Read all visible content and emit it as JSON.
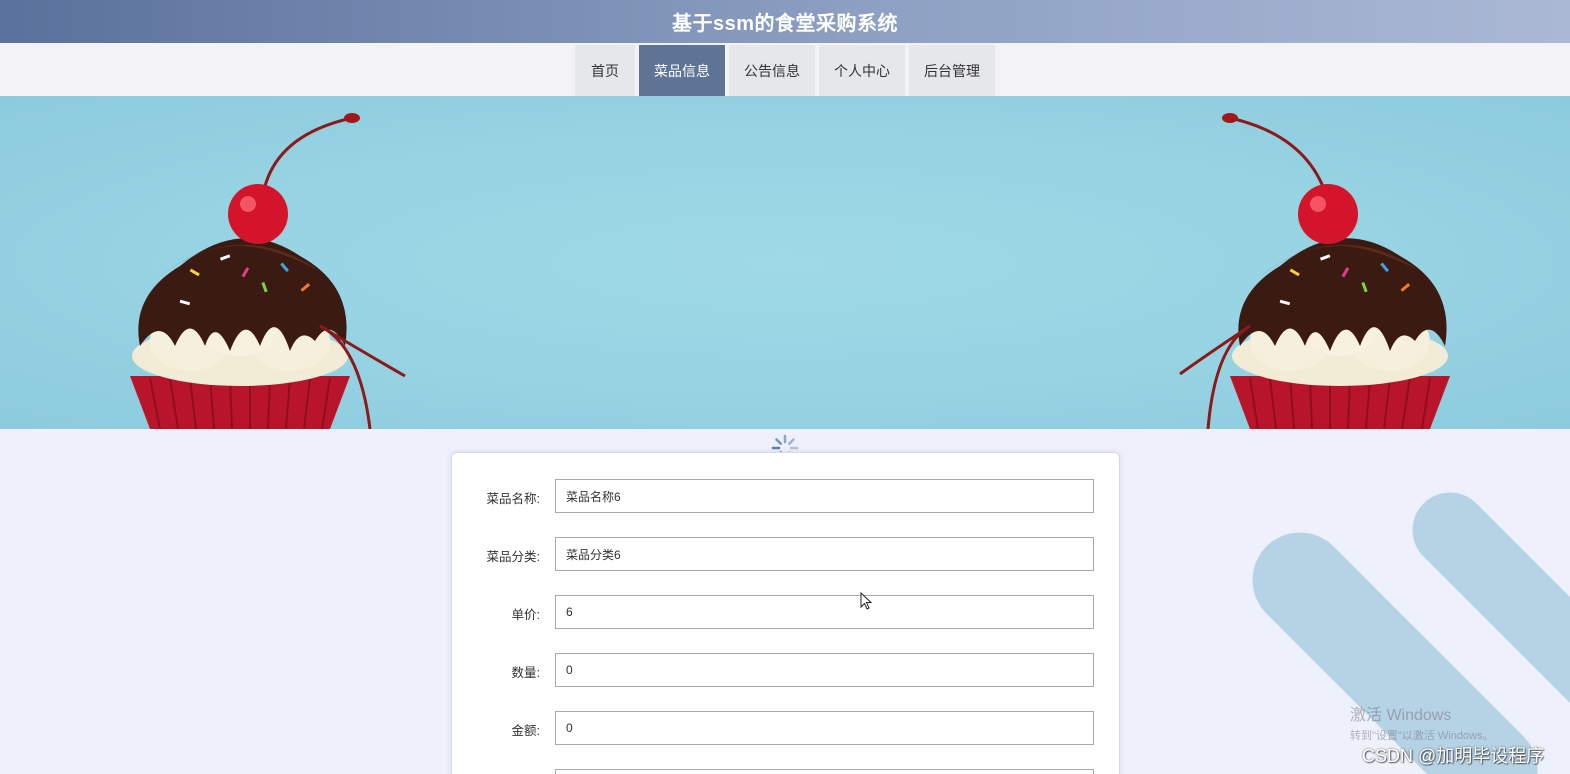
{
  "header": {
    "title": "基于ssm的食堂采购系统"
  },
  "nav": {
    "items": [
      {
        "label": "首页"
      },
      {
        "label": "菜品信息",
        "active": true
      },
      {
        "label": "公告信息"
      },
      {
        "label": "个人中心"
      },
      {
        "label": "后台管理"
      }
    ]
  },
  "form": {
    "fields": [
      {
        "label": "菜品名称:",
        "value": "菜品名称6"
      },
      {
        "label": "菜品分类:",
        "value": "菜品分类6"
      },
      {
        "label": "单价:",
        "value": "6"
      },
      {
        "label": "数量:",
        "value": "0"
      },
      {
        "label": "金额:",
        "value": "0"
      }
    ]
  },
  "watermark": {
    "title": "激活 Windows",
    "subtitle": "转到\"设置\"以激活 Windows。"
  },
  "credit": "CSDN @加明毕设程序",
  "colors": {
    "header_start": "#5a719b",
    "nav_active": "#5f7396",
    "page_bg": "#eef1fb",
    "banner_bg": "#96d3e3"
  }
}
